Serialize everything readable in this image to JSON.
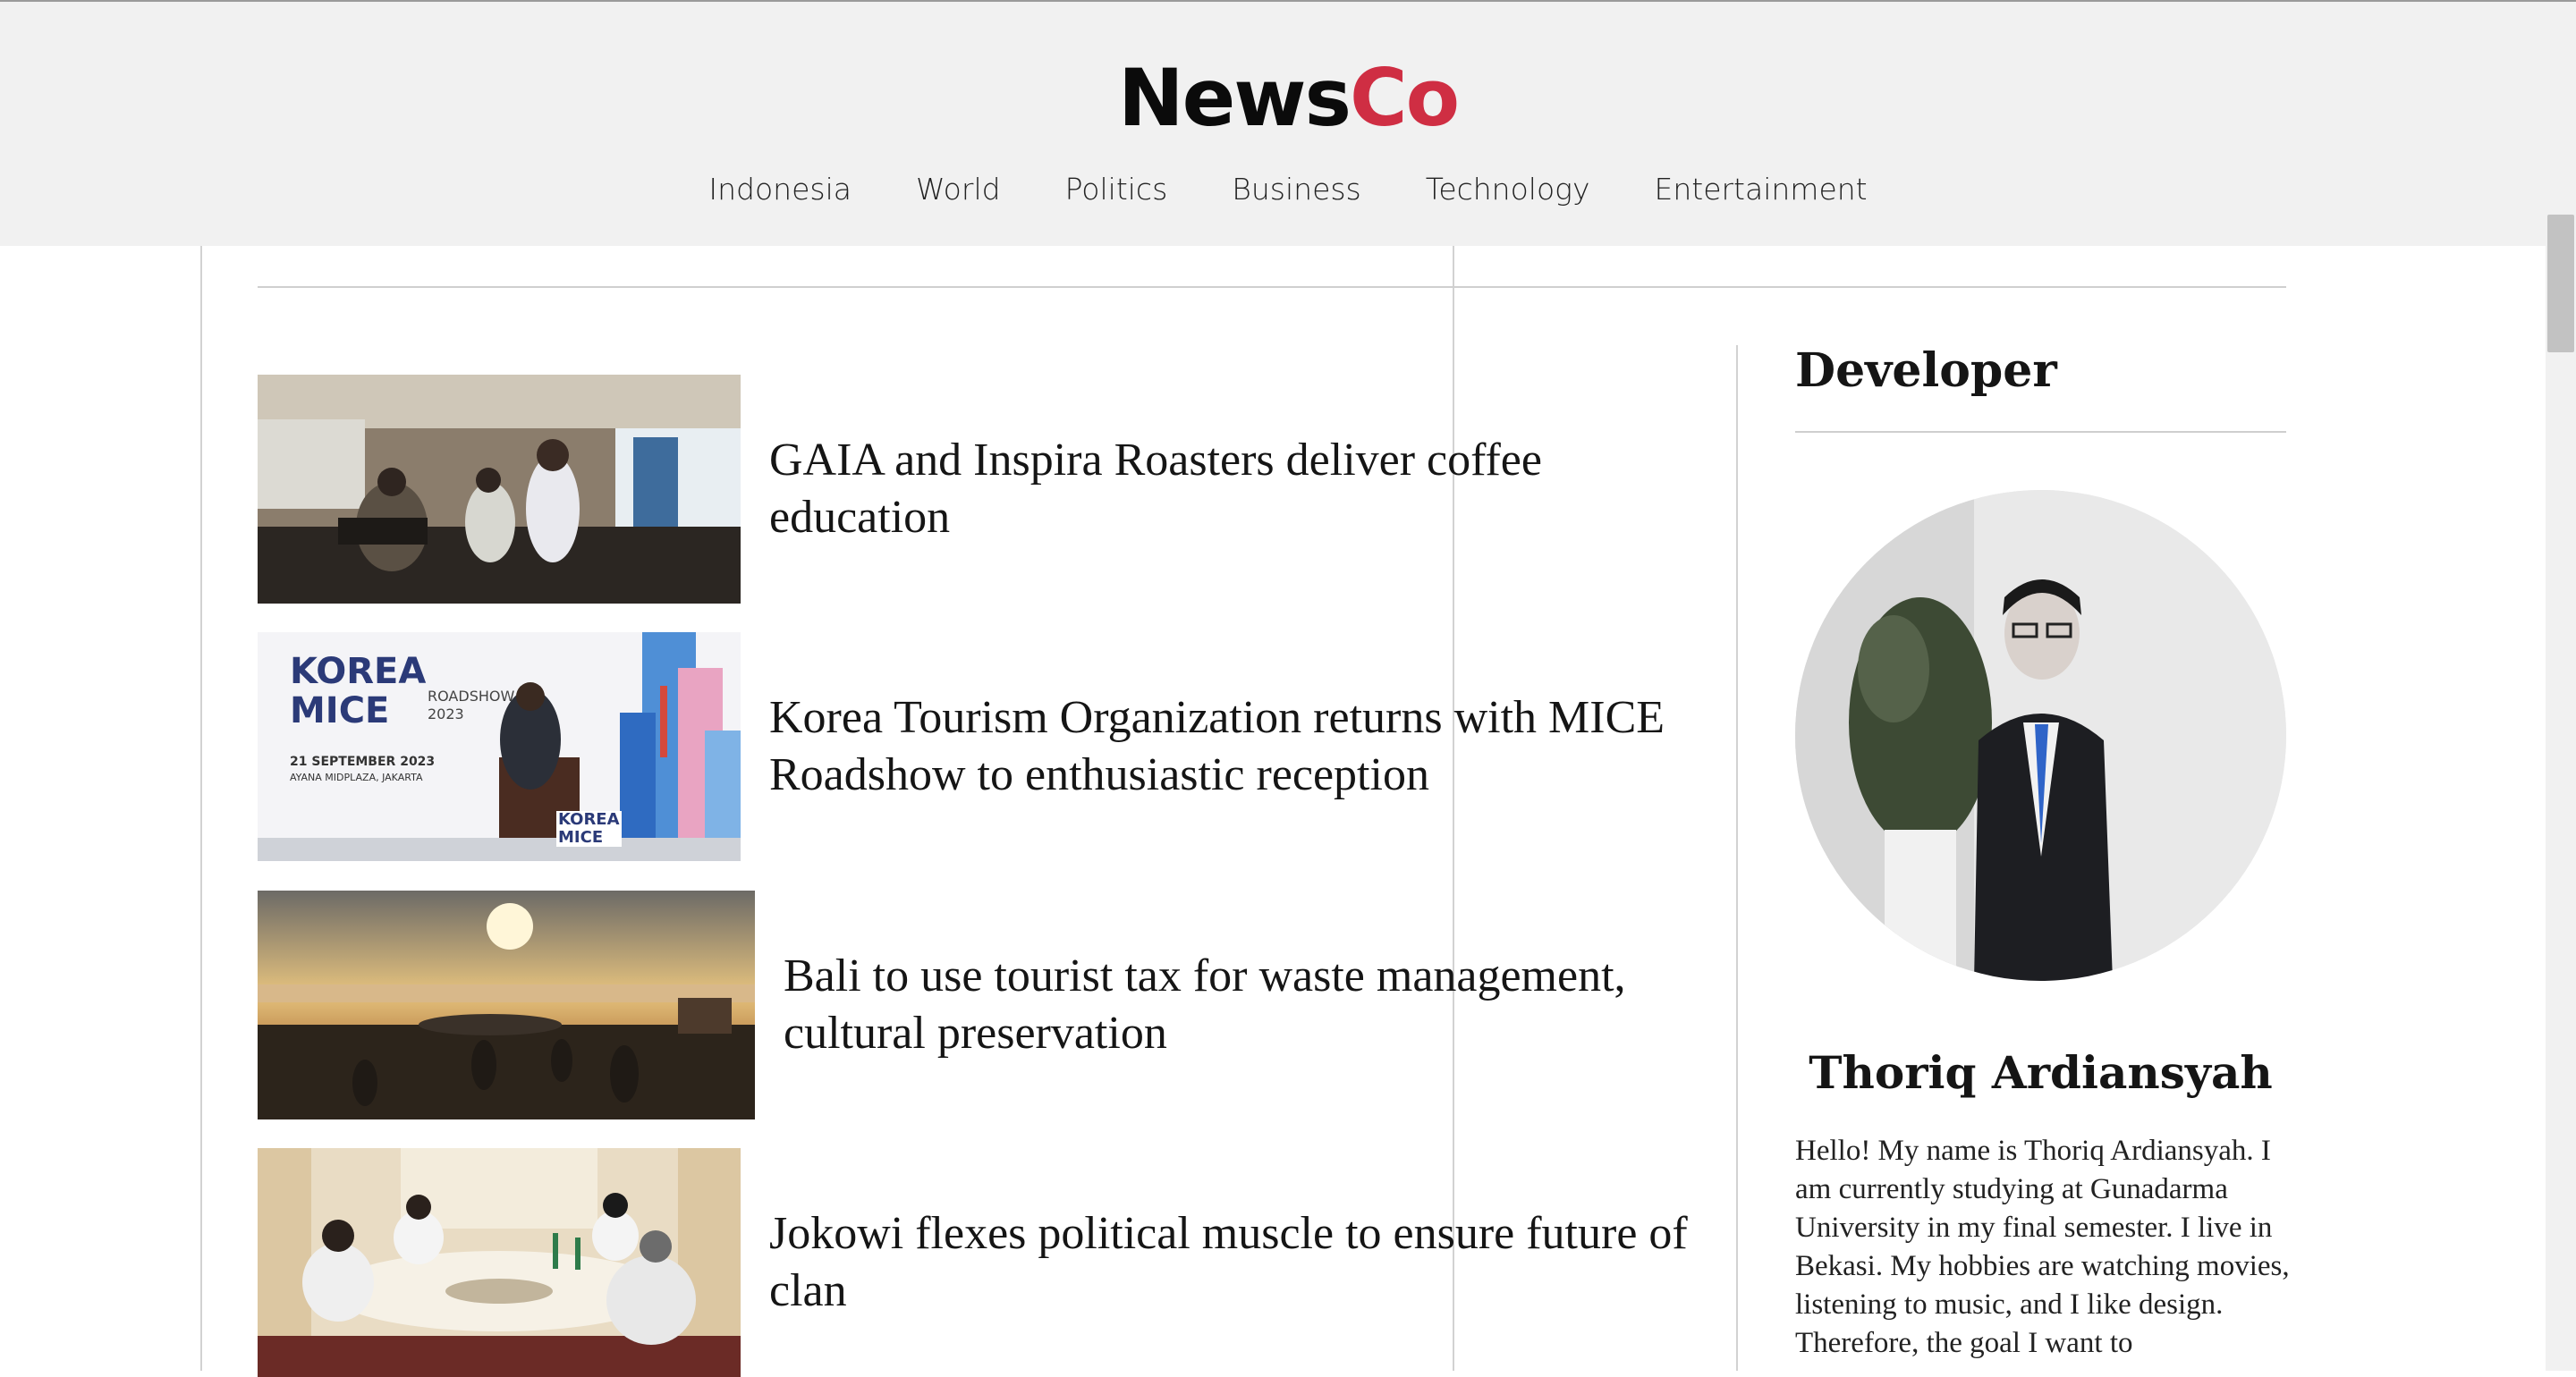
{
  "brand": {
    "part1": "News",
    "part2": "Co",
    "color_dark": "#0b0b0b",
    "color_accent": "#cf2e43"
  },
  "nav": [
    "Indonesia",
    "World",
    "Politics",
    "Business",
    "Technology",
    "Entertainment"
  ],
  "articles": [
    {
      "title": "GAIA and Inspira Roasters deliver coffee education",
      "image": "coffee-workshop-photo"
    },
    {
      "title": "Korea Tourism Organization returns with MICE Roadshow to enthusiastic reception",
      "image": "korea-mice-roadshow-photo"
    },
    {
      "title": "Bali to use tourist tax for waste management, cultural preservation",
      "image": "bali-beach-sunset-photo"
    },
    {
      "title": "Jokowi flexes political muscle to ensure future of clan",
      "image": "dinner-meeting-photo"
    }
  ],
  "korea_banner": {
    "line1": "KOREA",
    "line2": "MICE",
    "sub1": "ROADSHOW",
    "sub2": "2023",
    "date": "21 SEPTEMBER 2023",
    "venue": "AYANA MIDPLAZA, JAKARTA",
    "podium1": "KOREA",
    "podium2": "MICE"
  },
  "sidebar": {
    "heading": "Developer",
    "name": "Thoriq Ardiansyah",
    "bio": "Hello! My name is Thoriq Ardiansyah. I am currently studying at Gunadarma University in my final semester. I live in Bekasi. My hobbies are watching movies, listening to music, and I like design. Therefore, the goal I want to"
  }
}
